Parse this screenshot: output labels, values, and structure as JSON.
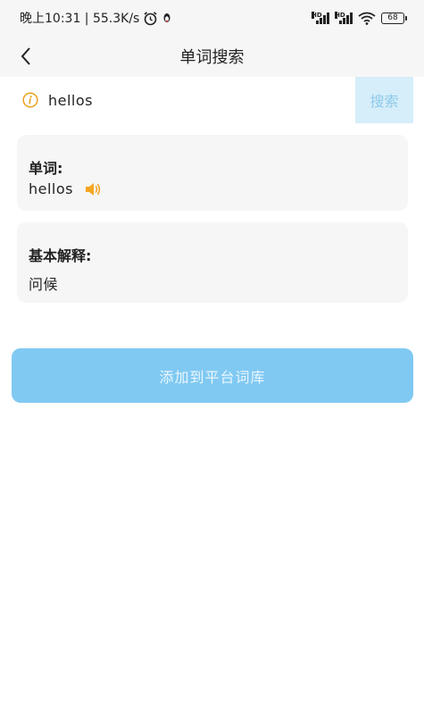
{
  "status_bar": {
    "time_speed": "晚上10:31 | 55.3K/s",
    "battery": "68"
  },
  "header": {
    "title": "单词搜索"
  },
  "search": {
    "value": "hellos",
    "button_label": "搜索"
  },
  "word_card": {
    "label": "单词:",
    "value": "hellos"
  },
  "meaning_card": {
    "label": "基本解释:",
    "value": "问候"
  },
  "actions": {
    "add_label": "添加到平台词库"
  },
  "colors": {
    "accent": "#80c9f2",
    "info_icon": "#e9a21f",
    "speaker_icon": "#f5a623"
  }
}
